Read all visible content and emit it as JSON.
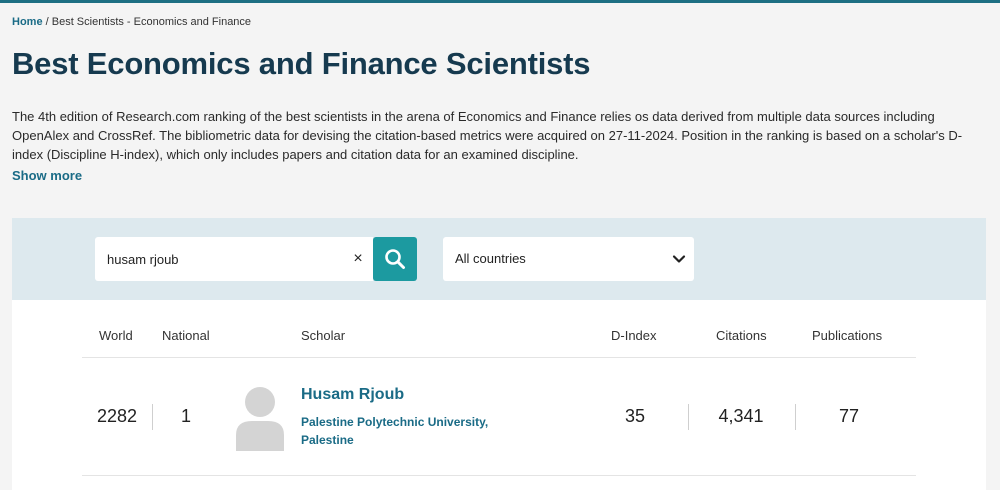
{
  "breadcrumb": {
    "home": "Home",
    "separator": " / ",
    "current": "Best Scientists - Economics and Finance"
  },
  "page": {
    "title": "Best Economics and Finance Scientists",
    "description": "The 4th edition of Research.com ranking of the best scientists in the arena of Economics and Finance relies os data derived from multiple data sources including OpenAlex and CrossRef. The bibliometric data for devising the citation-based metrics were acquired on 27-11-2024. Position in the ranking is based on a scholar's D-index (Discipline H-index), which only includes papers and citation data for an examined discipline.",
    "show_more": "Show more"
  },
  "search": {
    "value": "husam rjoub",
    "clear_symbol": "×",
    "country_selected": "All countries"
  },
  "table": {
    "headers": {
      "world": "World",
      "national": "National",
      "scholar": "Scholar",
      "dindex": "D-Index",
      "citations": "Citations",
      "publications": "Publications"
    },
    "rows": [
      {
        "world": "2282",
        "national": "1",
        "name": "Husam Rjoub",
        "affiliation": "Palestine Polytechnic University, Palestine",
        "dindex": "35",
        "citations": "4,341",
        "publications": "77"
      }
    ]
  },
  "colors": {
    "accent": "#1a6b86",
    "title": "#163a4f",
    "search_button": "#1c9aa0",
    "search_panel": "#dde9ee"
  },
  "icons": {
    "search": "search-icon",
    "clear": "close-icon",
    "dropdown": "chevron-down-icon",
    "avatar": "user-avatar-icon"
  }
}
